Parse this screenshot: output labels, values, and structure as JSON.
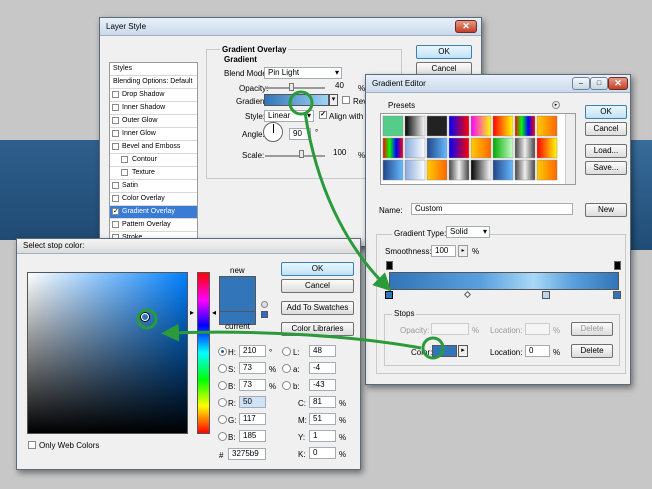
{
  "layer_style": {
    "title": "Layer Style",
    "ok": "OK",
    "cancel": "Cancel",
    "styles_header": "Styles",
    "items": [
      "Blending Options: Default",
      "Drop Shadow",
      "Inner Shadow",
      "Outer Glow",
      "Inner Glow",
      "Bevel and Emboss",
      "Contour",
      "Texture",
      "Satin",
      "Color Overlay",
      "Gradient Overlay",
      "Pattern Overlay",
      "Stroke"
    ],
    "section_title": "Gradient Overlay",
    "sub_title": "Gradient",
    "blend_mode_label": "Blend Mode:",
    "blend_mode_value": "Pin Light",
    "opacity_label": "Opacity:",
    "opacity_value": "40",
    "gradient_label": "Gradient:",
    "reverse_label": "Rev",
    "style_label": "Style:",
    "style_value": "Linear",
    "align_label": "Align with Lay",
    "angle_label": "Angle:",
    "angle_value": "90",
    "scale_label": "Scale:",
    "scale_value": "100",
    "percent": "%",
    "degree": "°"
  },
  "gradient_editor": {
    "title": "Gradient Editor",
    "presets_label": "Presets",
    "ok": "OK",
    "cancel": "Cancel",
    "load": "Load...",
    "save": "Save...",
    "name_label": "Name:",
    "name_value": "Custom",
    "new": "New",
    "gradient_type_label": "Gradient Type:",
    "gradient_type_value": "Solid",
    "smoothness_label": "Smoothness:",
    "smoothness_value": "100",
    "percent": "%",
    "stops_label": "Stops",
    "opacity_label": "Opacity:",
    "location_label": "Location:",
    "delete": "Delete",
    "color_label": "Color:",
    "location_value": "0",
    "accent_color": "#3275b9"
  },
  "color_picker": {
    "title": "Select stop color:",
    "ok": "OK",
    "cancel": "Cancel",
    "add_to_swatches": "Add To Swatches",
    "color_libraries": "Color Libraries",
    "new_label": "new",
    "current_label": "current",
    "only_web_colors": "Only Web Colors",
    "h_label": "H:",
    "h_value": "210",
    "h_unit": "°",
    "s_label": "S:",
    "s_value": "73",
    "s_unit": "%",
    "b_label": "B:",
    "b_value": "73",
    "b_unit": "%",
    "r_label": "R:",
    "r_value": "50",
    "g_label": "G:",
    "g_value": "117",
    "bb_label": "B:",
    "bb_value": "185",
    "l_label": "L:",
    "l_value": "48",
    "a_label": "a:",
    "a_value": "-4",
    "lb_label": "b:",
    "lb_value": "-43",
    "c_label": "C:",
    "c_value": "81",
    "m_label": "M:",
    "m_value": "51",
    "y_label": "Y:",
    "y_value": "1",
    "k_label": "K:",
    "k_value": "0",
    "pct": "%",
    "hex_label": "#",
    "hex_value": "3275b9",
    "new_color": "#3275b9",
    "current_color": "#3275b9"
  }
}
